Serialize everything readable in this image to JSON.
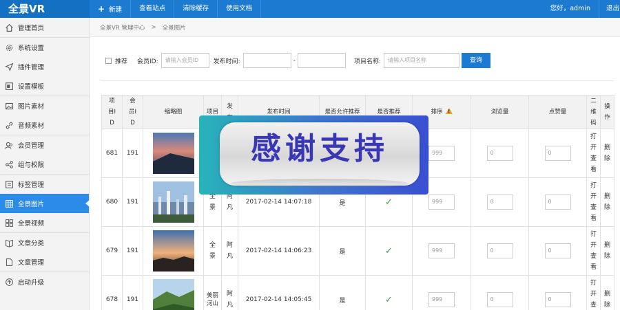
{
  "brand": "全景VR",
  "topnav": {
    "new": "新建",
    "view_site": "查看站点",
    "clear_cache": "清除缓存",
    "docs": "使用文档"
  },
  "user": {
    "greeting": "您好，admin",
    "logout": "退出"
  },
  "sidebar": {
    "items": [
      {
        "label": "管理首页",
        "icon": "home-icon"
      },
      {
        "label": "系统设置",
        "icon": "gear-icon"
      },
      {
        "label": "插件管理",
        "icon": "paper-plane-icon"
      },
      {
        "label": "设置模板",
        "icon": "template-icon"
      },
      {
        "label": "图片素材",
        "icon": "image-icon"
      },
      {
        "label": "音频素材",
        "icon": "link-icon"
      },
      {
        "label": "会员管理",
        "icon": "users-icon"
      },
      {
        "label": "组与权限",
        "icon": "share-icon"
      },
      {
        "label": "标签管理",
        "icon": "tag-icon"
      },
      {
        "label": "全景图片",
        "icon": "panorama-icon"
      },
      {
        "label": "全景视频",
        "icon": "grid-icon"
      },
      {
        "label": "文章分类",
        "icon": "book-icon"
      },
      {
        "label": "文章管理",
        "icon": "document-icon"
      },
      {
        "label": "启动升级",
        "icon": "upgrade-icon"
      }
    ],
    "active": "全景图片"
  },
  "breadcrumb": {
    "root": "全景VR 管理中心",
    "separator": ">",
    "current": "全景图片"
  },
  "filters": {
    "recommend_label": "推荐",
    "member_label": "会员ID:",
    "member_placeholder": "请输入会员ID",
    "date_label": "发布时间:",
    "date_separator": "-",
    "name_label": "项目名称:",
    "name_placeholder": "请输入项目名称",
    "query_button": "查询"
  },
  "table": {
    "headers": {
      "id": "项目ID",
      "member": "会员ID",
      "thumb": "缩略图",
      "project": "项目",
      "publisher": "发布",
      "time": "发布时间",
      "allow_rec": "是否允许推荐",
      "is_rec": "是否推荐",
      "sort": "排序",
      "views": "浏览量",
      "likes": "点赞量",
      "qrcode": "二维码",
      "ops": "操作"
    },
    "rows": [
      {
        "id": "681",
        "member": "191",
        "project": "",
        "publisher": "",
        "time": "",
        "allow_rec": "",
        "is_rec": "",
        "sort": "999",
        "views": "0",
        "likes": "0",
        "qrcode": "打开查看",
        "ops": "删除"
      },
      {
        "id": "680",
        "member": "191",
        "project": "全景",
        "publisher": "阿凡",
        "time": "2017-02-14 14:07:18",
        "allow_rec": "是",
        "is_rec": "✓",
        "sort": "999",
        "views": "0",
        "likes": "0",
        "qrcode": "打开查看",
        "ops": "删除"
      },
      {
        "id": "679",
        "member": "191",
        "project": "全景",
        "publisher": "阿凡",
        "time": "2017-02-14 14:06:23",
        "allow_rec": "是",
        "is_rec": "✓",
        "sort": "999",
        "views": "0",
        "likes": "0",
        "qrcode": "打开查看",
        "ops": "删除"
      },
      {
        "id": "678",
        "member": "191",
        "project": "美丽河山",
        "publisher": "阿凡",
        "time": "2017-02-14 14:05:45",
        "allow_rec": "是",
        "is_rec": "✓",
        "sort": "999",
        "views": "0",
        "likes": "0",
        "qrcode": "打开查看",
        "ops": "删除"
      }
    ]
  },
  "overlay": {
    "text": "感谢支持"
  },
  "colors": {
    "primary": "#1c7ad0",
    "active": "#2c8ae8",
    "check": "#2aa23c",
    "warn": "#e1a325"
  }
}
